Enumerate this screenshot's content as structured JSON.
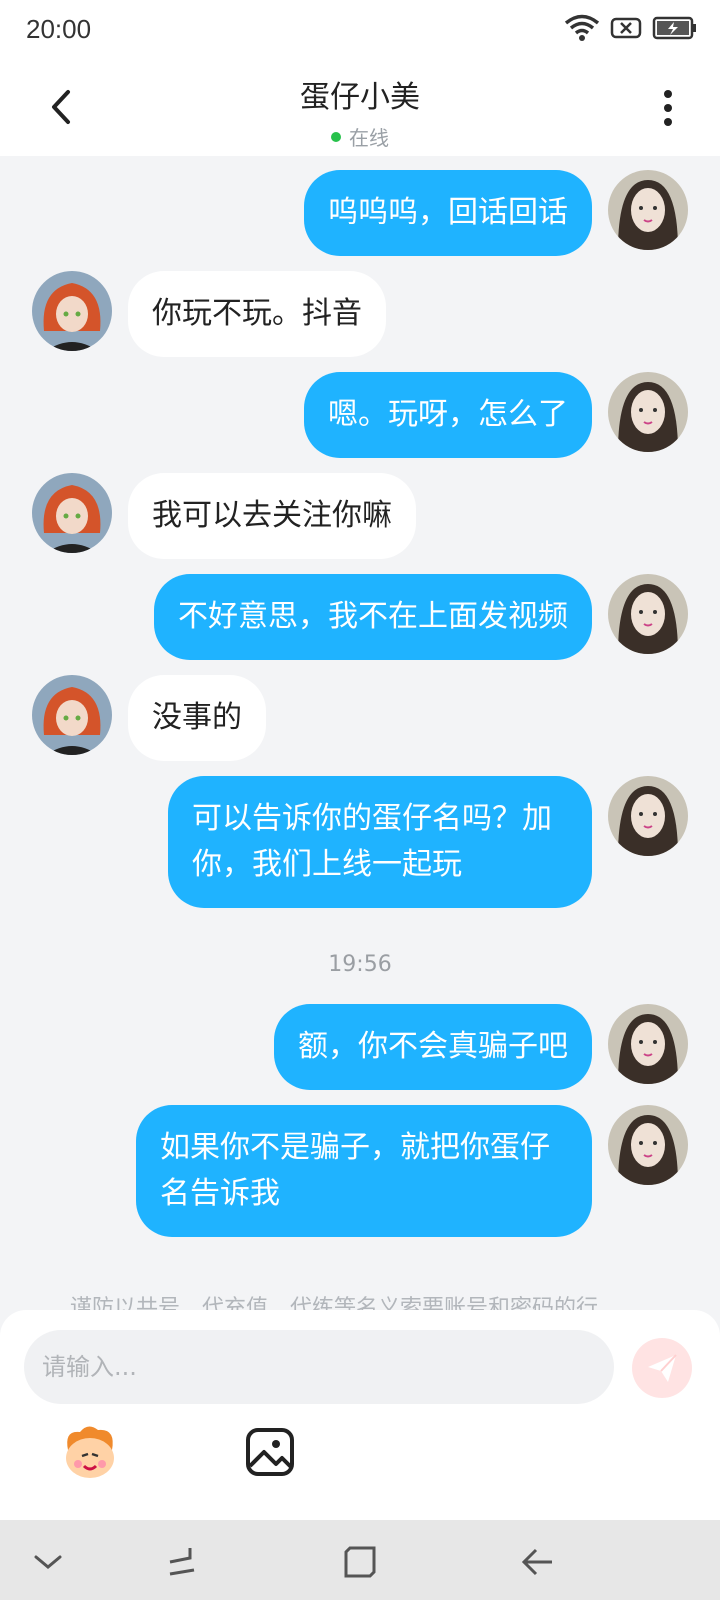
{
  "status": {
    "time": "20:00"
  },
  "header": {
    "title": "蛋仔小美",
    "status": "在线"
  },
  "messages": {
    "m1": "呜呜呜，回话回话",
    "m2": "你玩不玩。抖音",
    "m3": "嗯。玩呀，怎么了",
    "m4": "我可以去关注你嘛",
    "m5": "不好意思，我不在上面发视频",
    "m6": "没事的",
    "m7": "可以告诉你的蛋仔名吗？加你，我们上线一起玩",
    "time_sep": "19:56",
    "m8": "额，你不会真骗子吧",
    "m9": "如果你不是骗子，就把你蛋仔名告诉我"
  },
  "notice": "谨防以共号、代充值、代练等名义索要账号和密码的行",
  "input": {
    "placeholder": "请输入..."
  },
  "colors": {
    "bubble_me": "#1fb3ff",
    "online_dot": "#27c14b",
    "send_bg": "#ffe3e3"
  },
  "icons": [
    "wifi-icon",
    "battery-icon",
    "back-icon",
    "more-icon",
    "send-icon",
    "emoji-icon",
    "image-icon",
    "nav-down-icon",
    "nav-recents-icon",
    "nav-home-icon",
    "nav-back-icon"
  ]
}
